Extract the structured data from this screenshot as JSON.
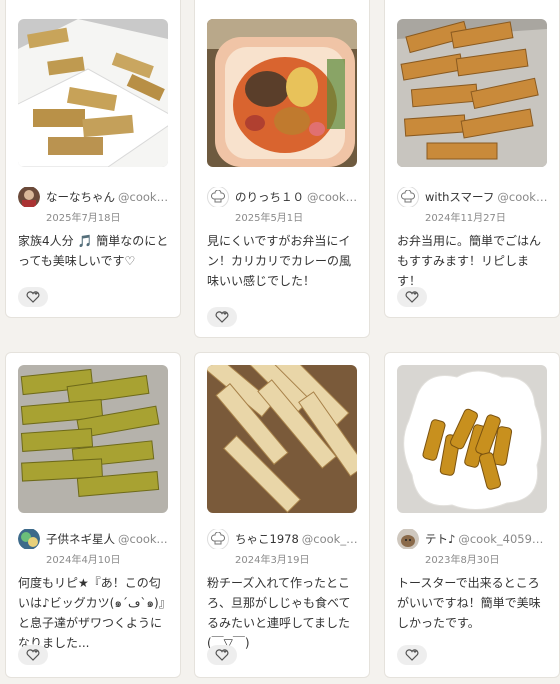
{
  "cards": [
    {
      "name": "なーなちゃん",
      "handle": "@cook_4...",
      "date": "2025年7月18日",
      "comment": "家族4人分 🎵 簡単なのにとっても美味しいです♡"
    },
    {
      "name": "のりっち１０",
      "handle": "@cook_4...",
      "date": "2025年5月1日",
      "comment": "見にくいですがお弁当にイン！カリカリでカレーの風味いい感じでした！"
    },
    {
      "name": "withスマーフ",
      "handle": "@cook_...",
      "date": "2024年11月27日",
      "comment": "お弁当用に。簡単でごはんもすすみます！リピします！"
    },
    {
      "name": "子供ネギ星人",
      "handle": "@cook...",
      "date": "2024年4月10日",
      "comment": "何度もリピ★『あ！この匂いは♪ビッグカツ(๑´ڡ`๑)』と息子達がザワつくようになりました..."
    },
    {
      "name": "ちゃこ1978",
      "handle": "@cook_40...",
      "date": "2024年3月19日",
      "comment": "粉チーズ入れて作ったところ、旦那がしじゃも食べてるみたいと連呼してました(￣▽￣)"
    },
    {
      "name": "テト♪",
      "handle": "@cook_40597...",
      "date": "2023年8月30日",
      "comment": "トースターで出来るところがいいですね！簡単で美味しかったです。"
    }
  ]
}
